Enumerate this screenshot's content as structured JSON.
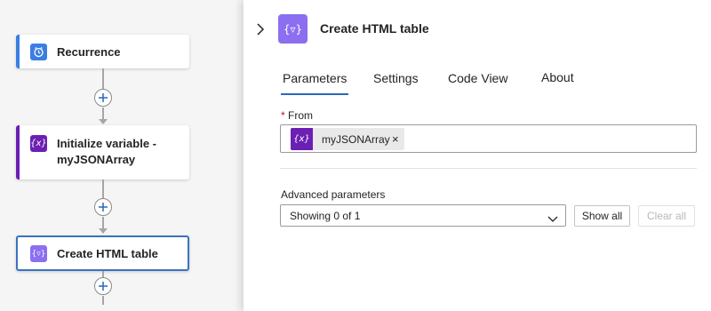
{
  "canvas": {
    "nodes": [
      {
        "title": "Recurrence",
        "icon": "clock-icon",
        "color": "#3a7ee3"
      },
      {
        "title": "Initialize variable - myJSONArray",
        "title_line1": "Initialize variable -",
        "title_line2": "myJSONArray",
        "icon": "variable-icon",
        "color": "#6c1fb3"
      },
      {
        "title": "Create HTML table",
        "icon": "data-operation-icon",
        "color": "#8b6ff0"
      }
    ]
  },
  "panel": {
    "title": "Create HTML table",
    "tabs": [
      {
        "label": "Parameters",
        "active": true
      },
      {
        "label": "Settings",
        "active": false
      },
      {
        "label": "Code View",
        "active": false
      },
      {
        "label": "About",
        "active": false
      }
    ],
    "from_field": {
      "required_mark": "*",
      "label": "From",
      "token": "myJSONArray",
      "token_remove": "×"
    },
    "advanced": {
      "label": "Advanced parameters",
      "select_value": "Showing 0 of 1",
      "show_all": "Show all",
      "clear_all": "Clear all"
    }
  }
}
